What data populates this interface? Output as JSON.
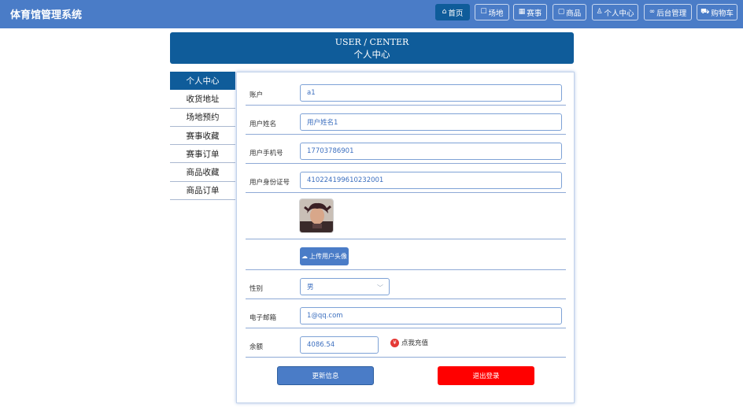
{
  "header": {
    "brand": "体育馆管理系统",
    "nav": [
      {
        "icon": "home-icon",
        "glyph": "⌂",
        "label": "首页",
        "active": true
      },
      {
        "icon": "venue-icon",
        "glyph": "☐",
        "label": "场地",
        "active": false
      },
      {
        "icon": "event-icon",
        "glyph": "▦",
        "label": "赛事",
        "active": false
      },
      {
        "icon": "goods-icon",
        "glyph": "▢",
        "label": "商品",
        "active": false
      },
      {
        "icon": "user-icon",
        "glyph": "♙",
        "label": "个人中心",
        "active": false
      },
      {
        "icon": "link-icon",
        "glyph": "∞",
        "label": "后台管理",
        "active": false
      },
      {
        "icon": "cart-icon",
        "glyph": "⛟",
        "label": "购物车",
        "active": false
      }
    ]
  },
  "banner": {
    "title_en": "USER / CENTER",
    "title_cn": "个人中心"
  },
  "sidebar": {
    "items": [
      {
        "label": "个人中心",
        "active": true
      },
      {
        "label": "收货地址",
        "active": false
      },
      {
        "label": "场地预约",
        "active": false
      },
      {
        "label": "赛事收藏",
        "active": false
      },
      {
        "label": "赛事订单",
        "active": false
      },
      {
        "label": "商品收藏",
        "active": false
      },
      {
        "label": "商品订单",
        "active": false
      }
    ]
  },
  "form": {
    "account": {
      "label": "账户",
      "value": "a1"
    },
    "name": {
      "label": "用户姓名",
      "value": "用户姓名1"
    },
    "phone": {
      "label": "用户手机号",
      "value": "17703786901"
    },
    "idcard": {
      "label": "用户身份证号",
      "value": "410224199610232001"
    },
    "upload_label": "上传用户头像",
    "gender": {
      "label": "性别",
      "value": "男"
    },
    "email": {
      "label": "电子邮箱",
      "value": "1@qq.com"
    },
    "balance": {
      "label": "余额",
      "value": "4086.54",
      "recharge": "点我充值"
    },
    "update_button": "更新信息",
    "logout_button": "退出登录"
  },
  "colors": {
    "header": "#4a7cc7",
    "active": "#0f5c9a",
    "danger": "#ff0000"
  }
}
